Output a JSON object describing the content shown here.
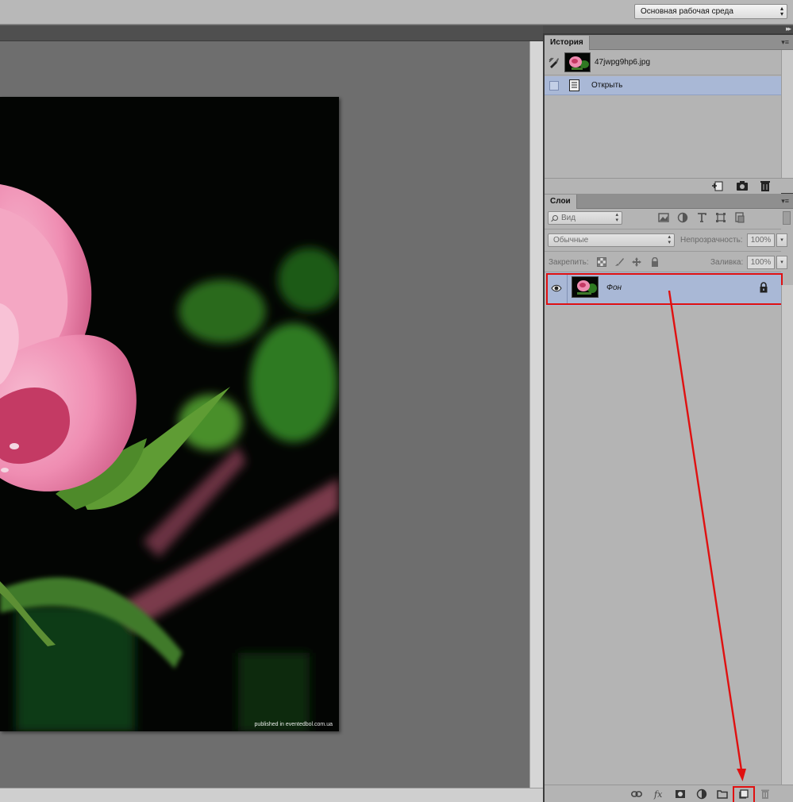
{
  "workspace_selector": {
    "value": "Основная рабочая среда"
  },
  "document": {
    "watermark": "published in eventedbol.com.ua"
  },
  "history_panel": {
    "tab_label": "История",
    "snapshot_name": "47jwpg9hp6.jpg",
    "steps": [
      {
        "label": "Открыть",
        "selected": true
      }
    ],
    "footer_icons": [
      "new-document-from-state-icon",
      "camera-icon",
      "trash-icon"
    ]
  },
  "layers_panel": {
    "tab_label": "Слои",
    "filter_kind": "Вид",
    "filter_icons": [
      "image-filter-icon",
      "adjustment-filter-icon",
      "type-filter-icon",
      "shape-filter-icon",
      "smart-object-filter-icon"
    ],
    "blend_mode": "Обычные",
    "opacity_label": "Непрозрачность:",
    "opacity_value": "100%",
    "lock_label": "Закрепить:",
    "lock_icons": [
      "lock-transparency-icon",
      "lock-pixels-icon",
      "lock-position-icon",
      "lock-all-icon"
    ],
    "fill_label": "Заливка:",
    "fill_value": "100%",
    "layers": [
      {
        "name": "Фон",
        "visible": true,
        "locked": true,
        "selected": true
      }
    ],
    "footer_icons": [
      "link-icon",
      "fx-icon",
      "mask-icon",
      "adjustment-layer-icon",
      "folder-icon",
      "new-layer-icon",
      "trash-icon"
    ]
  },
  "annotation": {
    "color": "#e01010"
  }
}
